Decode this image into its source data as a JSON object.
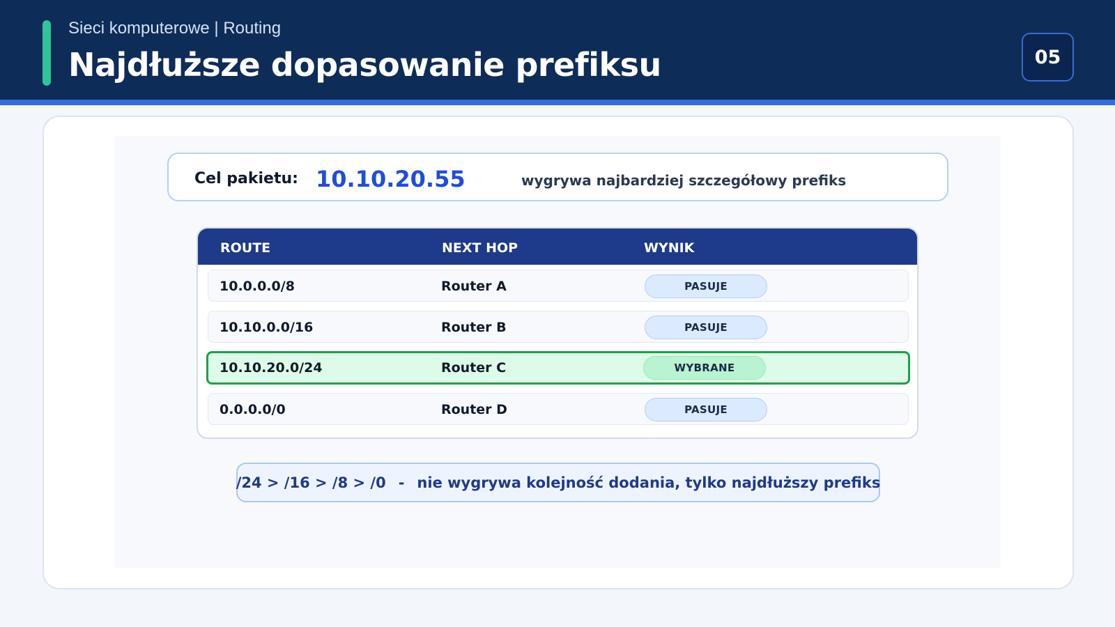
{
  "header": {
    "kicker": "Sieci komputerowe | Routing",
    "title": "Najdłuższe dopasowanie prefiksu",
    "page_number": "05"
  },
  "target": {
    "label": "Cel pakietu:",
    "ip": "10.10.20.55",
    "note": "wygrywa najbardziej szczegółowy prefiks"
  },
  "table": {
    "headers": [
      "ROUTE",
      "NEXT HOP",
      "WYNIK"
    ],
    "rows": [
      {
        "route": "10.0.0.0/8",
        "next_hop": "Router A",
        "result": "PASUJE",
        "selected": false
      },
      {
        "route": "10.10.0.0/16",
        "next_hop": "Router B",
        "result": "PASUJE",
        "selected": false
      },
      {
        "route": "10.10.20.0/24",
        "next_hop": "Router C",
        "result": "WYBRANE",
        "selected": true
      },
      {
        "route": "0.0.0.0/0",
        "next_hop": "Router D",
        "result": "PASUJE",
        "selected": false
      }
    ]
  },
  "footer": {
    "order": "/24 > /16 > /8 > /0",
    "separator": "-",
    "note": "nie wygrywa kolejność dodania, tylko najdłuższy prefiks"
  },
  "colors": {
    "header_bg": "#0e2c58",
    "accent": "#2fc49a",
    "highlight": "#1f4fd8",
    "selected_border": "#1ea04a",
    "selected_bg": "#dcfbe8"
  }
}
